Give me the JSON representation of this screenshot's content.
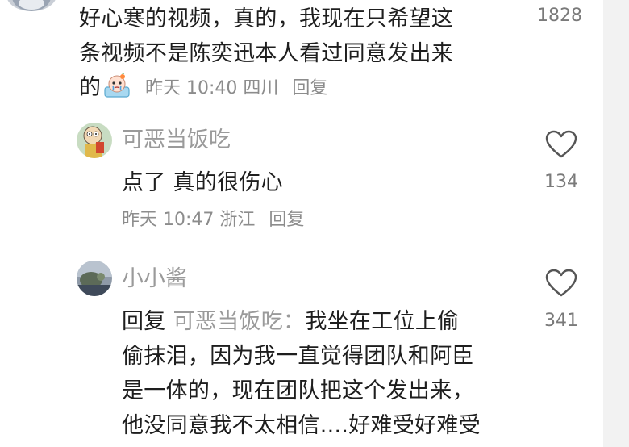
{
  "comments": [
    {
      "lines": [
        "好心寒的视频，真的，我现在只希望这",
        "条视频不是陈奕迅本人看过同意发出来",
        "的"
      ],
      "sticker_icon": "crying-cake-sticker",
      "time": "昨天 10:40",
      "location": "四川",
      "reply_label": "回复",
      "like_count": "1828"
    },
    {
      "username": "可恶当饭吃",
      "text": "点了 真的很伤心",
      "time": "昨天 10:47",
      "location": "浙江",
      "reply_label": "回复",
      "like_count": "134",
      "like_icon": "heart-outline-icon"
    },
    {
      "username": "小小酱",
      "reply_prefix": "回复",
      "reply_target": "可恶当饭吃：",
      "lines": [
        "我坐在工位上偷",
        "偷抹泪，因为我一直觉得团队和阿臣",
        "是一体的，现在团队把这个发出来，",
        "他没同意我不太相信....好难受好难受"
      ],
      "like_count": "341",
      "like_icon": "heart-outline-icon"
    }
  ]
}
